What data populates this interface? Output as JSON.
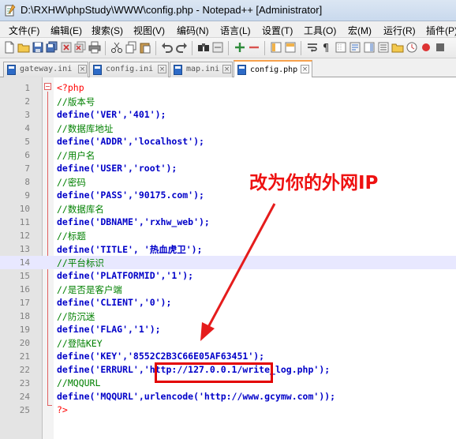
{
  "window": {
    "title": "D:\\RXHW\\phpStudy\\WWW\\config.php - Notepad++ [Administrator]"
  },
  "menu": [
    "文件(F)",
    "编辑(E)",
    "搜索(S)",
    "视图(V)",
    "编码(N)",
    "语言(L)",
    "设置(T)",
    "工具(O)",
    "宏(M)",
    "运行(R)",
    "插件(P)"
  ],
  "tabs": [
    {
      "label": "gateway.ini",
      "active": false
    },
    {
      "label": "config.ini",
      "active": false
    },
    {
      "label": "map.ini",
      "active": false
    },
    {
      "label": "config.php",
      "active": true
    }
  ],
  "editor": {
    "current_line": 14,
    "lines": [
      {
        "n": "1",
        "text": "<?php"
      },
      {
        "n": "2",
        "text": "//版本号"
      },
      {
        "n": "3",
        "text": "define('VER','401');"
      },
      {
        "n": "4",
        "text": "//数据库地址"
      },
      {
        "n": "5",
        "text": "define('ADDR','localhost');"
      },
      {
        "n": "6",
        "text": "//用户名"
      },
      {
        "n": "7",
        "text": "define('USER','root');"
      },
      {
        "n": "8",
        "text": "//密码"
      },
      {
        "n": "9",
        "text": "define('PASS','90175.com');"
      },
      {
        "n": "10",
        "text": "//数据库名"
      },
      {
        "n": "11",
        "text": "define('DBNAME','rxhw_web');"
      },
      {
        "n": "12",
        "text": "//标题"
      },
      {
        "n": "13",
        "text": "define('TITLE', '热血虎卫');"
      },
      {
        "n": "14",
        "text": "//平台标识"
      },
      {
        "n": "15",
        "text": "define('PLATFORMID','1');"
      },
      {
        "n": "16",
        "text": "//是否是客户端"
      },
      {
        "n": "17",
        "text": "define('CLIENT','0');"
      },
      {
        "n": "18",
        "text": "//防沉迷"
      },
      {
        "n": "19",
        "text": "define('FLAG','1');"
      },
      {
        "n": "20",
        "text": "//登陆KEY"
      },
      {
        "n": "21",
        "text": "define('KEY','8552C2B3C66E05AF63451');"
      },
      {
        "n": "22",
        "text": "define('ERRURL','http://127.0.0.1/write_log.php');"
      },
      {
        "n": "23",
        "text": "//MQQURL"
      },
      {
        "n": "24",
        "text": "define('MQQURL',urlencode('http://www.gcymw.com'));"
      },
      {
        "n": "25",
        "text": "?>"
      }
    ]
  },
  "annotation": {
    "text": "改为你的外网IP",
    "color": "#ee1111"
  }
}
